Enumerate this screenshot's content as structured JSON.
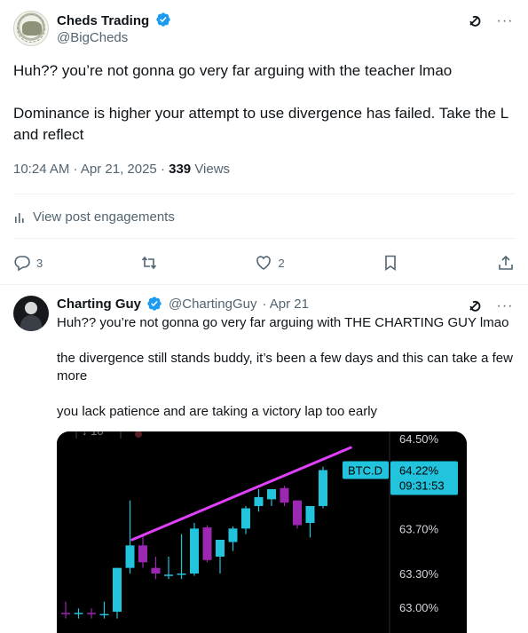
{
  "main_post": {
    "author_name": "Cheds Trading",
    "author_handle": "@BigCheds",
    "paragraphs": [
      "Huh?? you’re not gonna go very far arguing with the teacher lmao",
      "Dominance is higher your attempt to use divergence has failed.  Take the L and reflect"
    ],
    "timestamp": "10:24 AM · Apr 21, 2025 · ",
    "views_count": "339",
    "views_label": "Views",
    "engagements_label": "View post engagements",
    "replies": "3",
    "reposts": "",
    "likes": "2"
  },
  "reply": {
    "author_name": "Charting Guy",
    "author_handle": "@ChartingGuy",
    "date": "· Apr 21",
    "paragraphs": [
      "Huh?? you’re not gonna go very far arguing with THE CHARTING GUY lmao",
      "the divergence still stands buddy, it’s been a few days and this can take a few more",
      "you lack patience and are taking a victory lap too early"
    ]
  },
  "chart_data": {
    "type": "candlestick",
    "symbol_label": "BTC.D",
    "last_price": "64.22%",
    "countdown": "09:31:53",
    "top_left_value": "10",
    "y_tick_labels": [
      "64.50%",
      "63.70%",
      "63.30%",
      "63.00%"
    ],
    "y_ticks": [
      64.5,
      63.7,
      63.3,
      63.0
    ],
    "ylim": [
      62.9,
      64.55
    ],
    "candles": [
      {
        "o": 62.95,
        "h": 63.05,
        "l": 62.9,
        "c": 62.94
      },
      {
        "o": 62.94,
        "h": 62.99,
        "l": 62.9,
        "c": 62.95
      },
      {
        "o": 62.95,
        "h": 62.99,
        "l": 62.9,
        "c": 62.94
      },
      {
        "o": 62.94,
        "h": 63.05,
        "l": 62.9,
        "c": 62.94
      },
      {
        "o": 62.96,
        "h": 63.35,
        "l": 62.9,
        "c": 63.35
      },
      {
        "o": 63.35,
        "h": 63.95,
        "l": 63.3,
        "c": 63.55
      },
      {
        "o": 63.55,
        "h": 63.65,
        "l": 63.35,
        "c": 63.4
      },
      {
        "o": 63.35,
        "h": 63.45,
        "l": 63.25,
        "c": 63.3
      },
      {
        "o": 63.29,
        "h": 63.45,
        "l": 63.25,
        "c": 63.29
      },
      {
        "o": 63.29,
        "h": 63.65,
        "l": 63.25,
        "c": 63.3
      },
      {
        "o": 63.3,
        "h": 63.75,
        "l": 63.28,
        "c": 63.7
      },
      {
        "o": 63.71,
        "h": 63.73,
        "l": 63.4,
        "c": 63.42
      },
      {
        "o": 63.45,
        "h": 63.6,
        "l": 63.3,
        "c": 63.6
      },
      {
        "o": 63.58,
        "h": 63.72,
        "l": 63.5,
        "c": 63.7
      },
      {
        "o": 63.7,
        "h": 63.9,
        "l": 63.65,
        "c": 63.88
      },
      {
        "o": 63.9,
        "h": 64.05,
        "l": 63.85,
        "c": 63.98
      },
      {
        "o": 63.96,
        "h": 64.05,
        "l": 63.9,
        "c": 64.05
      },
      {
        "o": 64.06,
        "h": 64.08,
        "l": 63.9,
        "c": 63.93
      },
      {
        "o": 63.95,
        "h": 63.95,
        "l": 63.7,
        "c": 63.73
      },
      {
        "o": 63.75,
        "h": 63.9,
        "l": 63.62,
        "c": 63.9
      },
      {
        "o": 63.9,
        "h": 64.25,
        "l": 63.88,
        "c": 64.22
      }
    ],
    "trendline": {
      "x1": 5.5,
      "y1": 63.6,
      "x2": 22.5,
      "y2": 64.42
    },
    "colors": {
      "up": "#22c3dd",
      "down": "#9c27b0",
      "trendline": "#e040fb",
      "background": "#000000"
    }
  }
}
